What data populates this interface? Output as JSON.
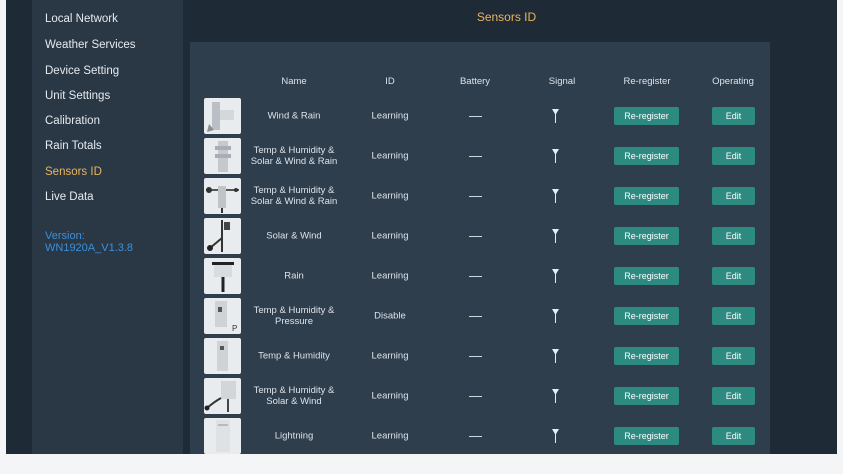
{
  "sidebar": {
    "items": [
      {
        "label": "Local Network",
        "active": false
      },
      {
        "label": "Weather Services",
        "active": false
      },
      {
        "label": "Device Setting",
        "active": false
      },
      {
        "label": "Unit Settings",
        "active": false
      },
      {
        "label": "Calibration",
        "active": false
      },
      {
        "label": "Rain Totals",
        "active": false
      },
      {
        "label": "Sensors ID",
        "active": true
      },
      {
        "label": "Live Data",
        "active": false
      }
    ],
    "version_label": "Version:",
    "version_value": "WN1920A_V1.3.8"
  },
  "page_title": "Sensors ID",
  "table": {
    "headers": [
      "Name",
      "ID",
      "Battery",
      "Signal",
      "Re-register",
      "Operating"
    ],
    "rows": [
      {
        "name_lines": [
          "Wind & Rain"
        ],
        "id": "Learning",
        "battery": "—",
        "reregister": "Re-register",
        "operating": "Edit",
        "thumb": "wind-rain-sensor"
      },
      {
        "name_lines": [
          "Temp & Humidity &",
          "Solar & Wind & Rain"
        ],
        "id": "Learning",
        "battery": "—",
        "reregister": "Re-register",
        "operating": "Edit",
        "thumb": "7in1-sensor"
      },
      {
        "name_lines": [
          "Temp & Humidity &",
          "Solar & Wind & Rain"
        ],
        "id": "Learning",
        "battery": "—",
        "reregister": "Re-register",
        "operating": "Edit",
        "thumb": "7in1-array-sensor"
      },
      {
        "name_lines": [
          "Solar & Wind"
        ],
        "id": "Learning",
        "battery": "—",
        "reregister": "Re-register",
        "operating": "Edit",
        "thumb": "solar-wind-sensor"
      },
      {
        "name_lines": [
          "Rain"
        ],
        "id": "Learning",
        "battery": "—",
        "reregister": "Re-register",
        "operating": "Edit",
        "thumb": "rain-gauge"
      },
      {
        "name_lines": [
          "Temp & Humidity &",
          "Pressure"
        ],
        "id": "Disable",
        "battery": "—",
        "reregister": "Re-register",
        "operating": "Edit",
        "thumb": "thp-sensor"
      },
      {
        "name_lines": [
          "Temp & Humidity"
        ],
        "id": "Learning",
        "battery": "—",
        "reregister": "Re-register",
        "operating": "Edit",
        "thumb": "th-sensor"
      },
      {
        "name_lines": [
          "Temp & Humidity &",
          "Solar & Wind"
        ],
        "id": "Learning",
        "battery": "—",
        "reregister": "Re-register",
        "operating": "Edit",
        "thumb": "th-solar-wind-sensor"
      },
      {
        "name_lines": [
          "Lightning"
        ],
        "id": "Learning",
        "battery": "—",
        "reregister": "Re-register",
        "operating": "Edit",
        "thumb": "lightning-sensor"
      }
    ]
  },
  "icons": {
    "signal": "signal-icon"
  },
  "colors": {
    "accent": "#e8b55c",
    "button": "#2d8a80",
    "version": "#3d8fd9",
    "background": "#1e2a36",
    "sidebar": "#2a3846",
    "panel": "#2f3e4d"
  }
}
